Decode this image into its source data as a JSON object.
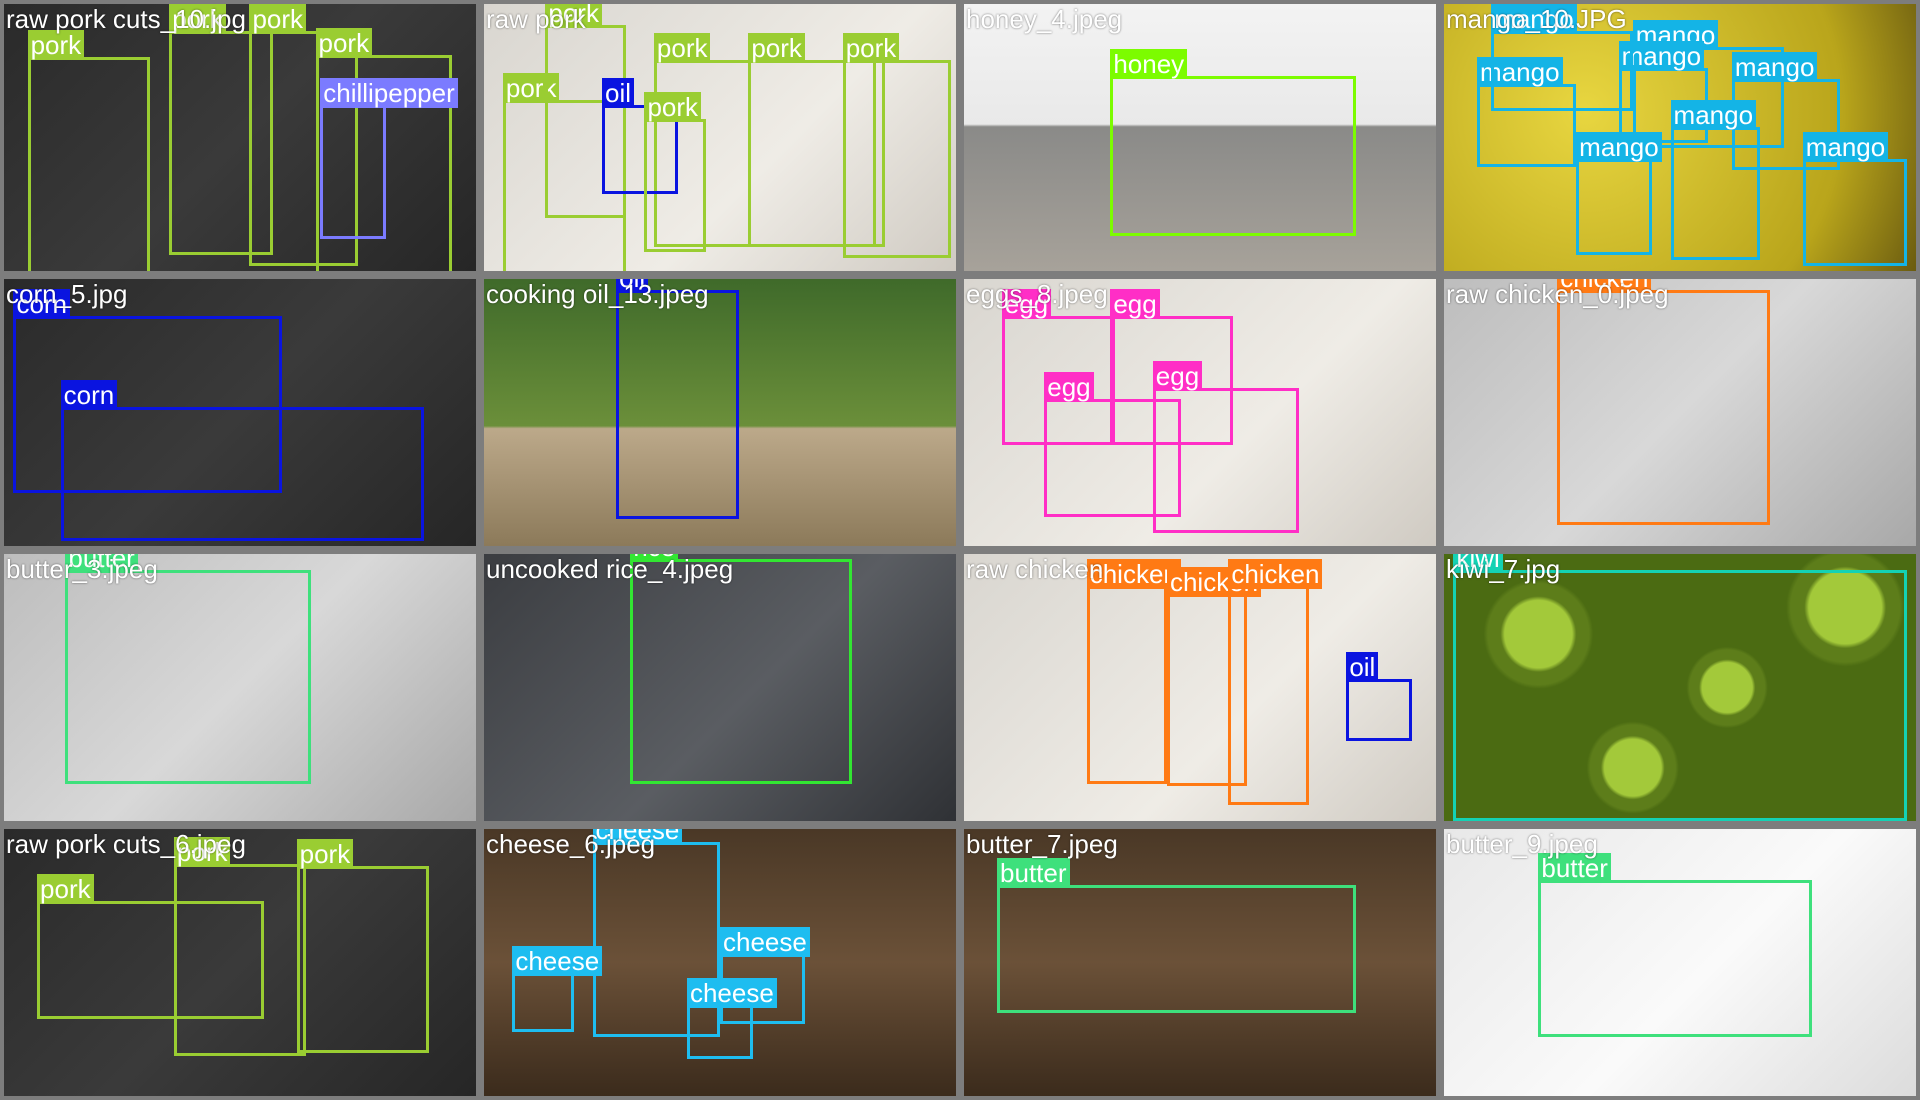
{
  "colors": {
    "pork": "#9acd32",
    "chillipepper": "#7b7bff",
    "oil": "#0a14e0",
    "honey": "#7cfc00",
    "mango": "#14b4e6",
    "corn": "#0a14e0",
    "egg": "#ff2ec6",
    "chicken": "#ff7a14",
    "butter": "#3ee07c",
    "rice": "#32e632",
    "kiwi": "#14d2b4",
    "cheese": "#1ebdf0"
  },
  "tiles": [
    {
      "title": "raw pork cuts_10.jpg",
      "bg": "dark",
      "items": [
        {
          "label": "pork",
          "cls": "pork"
        },
        {
          "label": "pork",
          "cls": "pork"
        },
        {
          "label": "pork",
          "cls": "pork"
        },
        {
          "label": "pork",
          "cls": "pork"
        },
        {
          "label": "chillipepper",
          "cls": "chillipepper"
        }
      ]
    },
    {
      "title": "raw pork",
      "bg": "light",
      "items": [
        {
          "label": "pork",
          "cls": "pork"
        },
        {
          "label": "pork",
          "cls": "pork"
        },
        {
          "label": "pork",
          "cls": "pork"
        },
        {
          "label": "pork",
          "cls": "pork"
        },
        {
          "label": "pork",
          "cls": "pork"
        },
        {
          "label": "oil",
          "cls": "oil"
        },
        {
          "label": "pork",
          "cls": "pork"
        }
      ]
    },
    {
      "title": "honey_4.jpeg",
      "bg": "wood",
      "items": [
        {
          "label": "honey",
          "cls": "honey"
        }
      ]
    },
    {
      "title": "mango_10.JPG",
      "bg": "mango",
      "items": [
        {
          "label": "mango",
          "cls": "mango"
        },
        {
          "label": "mango",
          "cls": "mango"
        },
        {
          "label": "mango",
          "cls": "mango"
        },
        {
          "label": "mango",
          "cls": "mango"
        },
        {
          "label": "mango",
          "cls": "mango"
        },
        {
          "label": "mango",
          "cls": "mango"
        },
        {
          "label": "mango",
          "cls": "mango"
        },
        {
          "label": "mango",
          "cls": "mango"
        }
      ]
    },
    {
      "title": "corn_5.jpg",
      "bg": "dark",
      "items": [
        {
          "label": "corn",
          "cls": "corn"
        },
        {
          "label": "corn",
          "cls": "corn"
        }
      ]
    },
    {
      "title": "cooking oil_13.jpeg",
      "bg": "green",
      "items": [
        {
          "label": "oil",
          "cls": "oil"
        }
      ]
    },
    {
      "title": "eggs_8.jpeg",
      "bg": "light",
      "items": [
        {
          "label": "egg",
          "cls": "egg"
        },
        {
          "label": "egg",
          "cls": "egg"
        },
        {
          "label": "egg",
          "cls": "egg"
        },
        {
          "label": "egg",
          "cls": "egg"
        }
      ]
    },
    {
      "title": "raw chicken_0.jpeg",
      "bg": "grey",
      "items": [
        {
          "label": "chicken",
          "cls": "chicken"
        }
      ]
    },
    {
      "title": "butter_3.jpeg",
      "bg": "grey",
      "items": [
        {
          "label": "butter",
          "cls": "butter"
        }
      ]
    },
    {
      "title": "uncooked rice_4.jpeg",
      "bg": "darkgrey",
      "items": [
        {
          "label": "rice",
          "cls": "rice"
        }
      ]
    },
    {
      "title": "raw chicken",
      "bg": "light",
      "items": [
        {
          "label": "chicken",
          "cls": "chicken"
        },
        {
          "label": "chicken",
          "cls": "chicken"
        },
        {
          "label": "chicken",
          "cls": "chicken"
        },
        {
          "label": "oil",
          "cls": "oil"
        }
      ]
    },
    {
      "title": "kiwi_7.jpg",
      "bg": "kiwi",
      "items": [
        {
          "label": "kiwi",
          "cls": "kiwi"
        }
      ]
    },
    {
      "title": "raw pork cuts_6.jpeg",
      "bg": "dark",
      "items": [
        {
          "label": "pork",
          "cls": "pork"
        },
        {
          "label": "pork",
          "cls": "pork"
        },
        {
          "label": "pork",
          "cls": "pork"
        }
      ]
    },
    {
      "title": "cheese_6.jpeg",
      "bg": "woodDark",
      "items": [
        {
          "label": "cheese",
          "cls": "cheese"
        },
        {
          "label": "cheese",
          "cls": "cheese"
        },
        {
          "label": "cheese",
          "cls": "cheese"
        },
        {
          "label": "cheese",
          "cls": "cheese"
        }
      ]
    },
    {
      "title": "butter_7.jpeg",
      "bg": "woodDark",
      "items": [
        {
          "label": "butter",
          "cls": "butter"
        }
      ]
    },
    {
      "title": "butter_9.jpeg",
      "bg": "pale",
      "items": [
        {
          "label": "butter",
          "cls": "butter"
        }
      ]
    }
  ]
}
